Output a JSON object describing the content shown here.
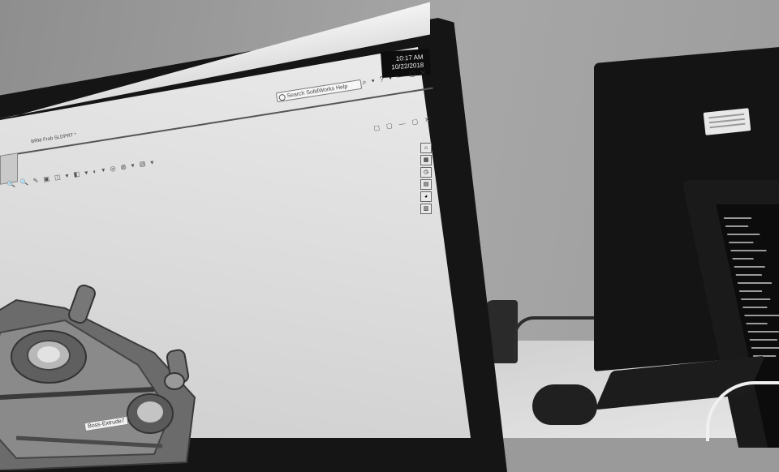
{
  "scene": {
    "taskbar": {
      "time": "10:17 AM",
      "date": "10/22/2018"
    },
    "solidworks": {
      "search_placeholder": "Search SolidWorks Help",
      "document_title": "BRM Frob SLDPRT *",
      "top_icons": "⌕ ▾ ? ▾ — ▢ ✕",
      "doc_icons": "▢ ▢ — ▢ ✕",
      "view_toolbar": "🔍 🔍 ✎ ▣ ◫ ▾ ◧ ▾ ◐ ▾ ◎ ◍ ▾ ▤ ▾",
      "tooltip": "Boss-Extrude7"
    },
    "colors": {
      "bezel": "#151515",
      "screen": "#e4e4e4",
      "wall": "#9f9f9f"
    }
  }
}
